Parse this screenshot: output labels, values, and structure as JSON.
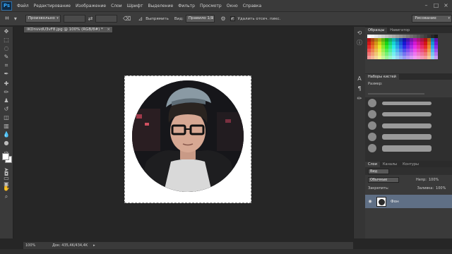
{
  "app": {
    "logo": "Ps",
    "menu": [
      "Файл",
      "Редактирование",
      "Изображение",
      "Слои",
      "Шрифт",
      "Выделение",
      "Фильтр",
      "Просмотр",
      "Окно",
      "Справка"
    ]
  },
  "options_bar": {
    "ratio_select": "Произвольно",
    "straighten_label": "Выпрямить",
    "view_label": "Вид:",
    "view_select": "Правило 1/3",
    "delete_cropped_label": "Удалить отсеч. пикс.",
    "workspace_select": "Рисование"
  },
  "document": {
    "tab_title": "IKDnvvdU3vF8.jpg @ 100% (RGB/8#) *",
    "zoom": "100%",
    "doc_info": "Док: 435,4K/434,4K"
  },
  "panels": {
    "swatches_tab": "Образцы",
    "navigator_tab": "Навигатор",
    "brush_presets_tab": "Наборы кистей",
    "size_label": "Размер:",
    "layers_tab": "Слои",
    "channels_tab": "Каналы",
    "paths_tab": "Контуры",
    "kind_select": "Вид",
    "blend_select": "Обычные",
    "opacity_label": "Непр:",
    "opacity_value": "100%",
    "lock_label": "Закрепить:",
    "fill_label": "Заливка:",
    "fill_value": "100%",
    "layer_name": "Фон"
  },
  "colors": {
    "accent": "#31a8ff",
    "selected_layer": "#5f6f85"
  }
}
